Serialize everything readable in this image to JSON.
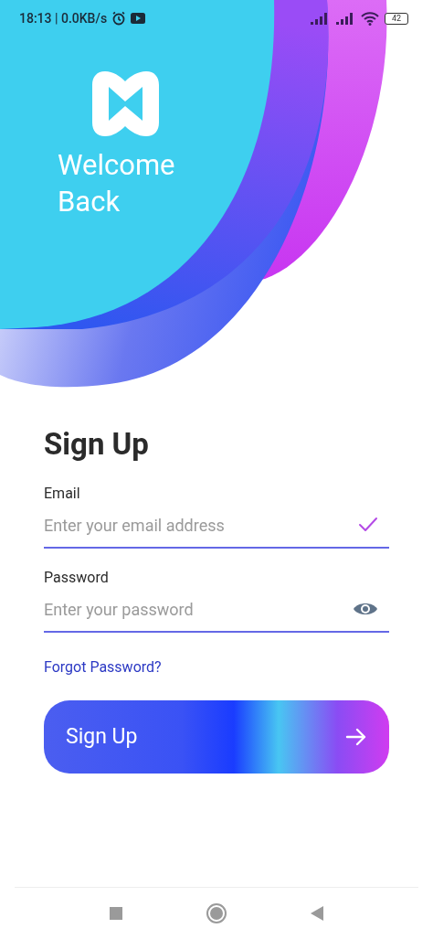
{
  "status_bar": {
    "time": "18:13 | 0.0KB/s",
    "battery": "42"
  },
  "header": {
    "title": "Welcome Back"
  },
  "form": {
    "title": "Sign Up",
    "fields": [
      {
        "kind": "email",
        "label": "Email",
        "placeholder": "Enter your email address"
      },
      {
        "kind": "password",
        "label": "Password",
        "placeholder": "Enter your password"
      }
    ],
    "forgot_link": "Forgot Password?",
    "submit": "Sign Up"
  }
}
